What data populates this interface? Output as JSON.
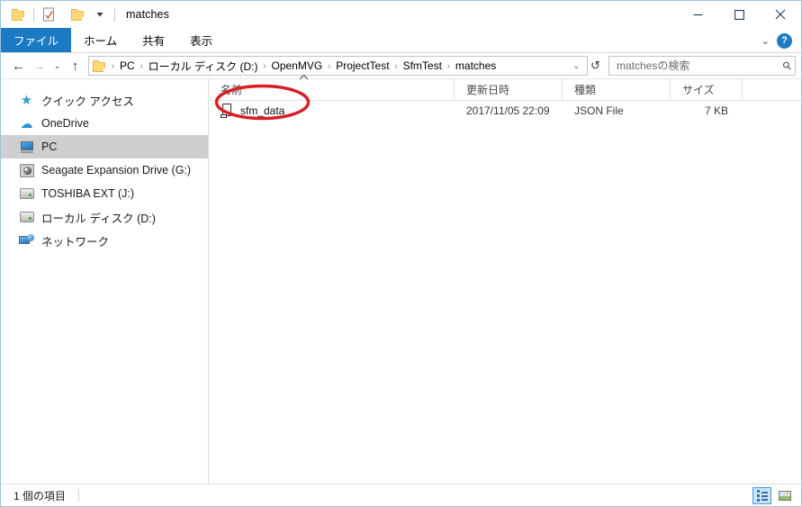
{
  "window": {
    "title": "matches",
    "quick_access": [
      {
        "name": "folder-icon",
        "label": "folder"
      },
      {
        "name": "properties-icon",
        "label": "properties"
      },
      {
        "name": "new-folder-icon",
        "label": "new folder"
      }
    ],
    "controls": {
      "minimize": "—",
      "maximize": "☐",
      "close": "✕"
    }
  },
  "ribbon": {
    "tabs": [
      {
        "label": "ファイル",
        "active": true
      },
      {
        "label": "ホーム",
        "active": false
      },
      {
        "label": "共有",
        "active": false
      },
      {
        "label": "表示",
        "active": false
      }
    ],
    "expand_icon": "⌄",
    "help_icon": "?"
  },
  "address": {
    "back_icon": "←",
    "forward_icon": "→",
    "recent_icon": "⌄",
    "up_icon": "↑",
    "breadcrumbs": [
      "PC",
      "ローカル ディスク (D:)",
      "OpenMVG",
      "ProjectTest",
      "SfmTest",
      "matches"
    ],
    "separator": "›",
    "dropdown_icon": "⌄",
    "refresh_icon": "↻"
  },
  "search": {
    "placeholder": "matchesの検索",
    "value": "",
    "icon": "search-icon"
  },
  "sidebar": {
    "items": [
      {
        "label": "クイック アクセス",
        "icon": "star-icon",
        "selected": false
      },
      {
        "label": "OneDrive",
        "icon": "cloud-icon",
        "selected": false
      },
      {
        "label": "PC",
        "icon": "computer-icon",
        "selected": true
      },
      {
        "label": "Seagate Expansion Drive (G:)",
        "icon": "external-drive-icon",
        "selected": false
      },
      {
        "label": "TOSHIBA EXT (J:)",
        "icon": "disk-drive-icon",
        "selected": false
      },
      {
        "label": "ローカル ディスク (D:)",
        "icon": "disk-drive-icon",
        "selected": false
      },
      {
        "label": "ネットワーク",
        "icon": "network-icon",
        "selected": false
      }
    ]
  },
  "filelist": {
    "columns": [
      {
        "label": "名前",
        "key": "name"
      },
      {
        "label": "更新日時",
        "key": "date"
      },
      {
        "label": "種類",
        "key": "type"
      },
      {
        "label": "サイズ",
        "key": "size"
      }
    ],
    "sort_caret": "▲",
    "rows": [
      {
        "name": "sfm_data",
        "date": "2017/11/05 22:09",
        "type": "JSON File",
        "size": "7 KB",
        "icon": "json-file-icon",
        "annotated": true
      }
    ]
  },
  "annotation": {
    "shape": "ellipse",
    "color": "#d81f26",
    "target": "sfm_data"
  },
  "status": {
    "item_count_text": "1 個の項目",
    "views": [
      {
        "name": "details-view",
        "active": true
      },
      {
        "name": "large-icons-view",
        "active": false
      }
    ]
  },
  "colors": {
    "accent": "#1a7bc4",
    "selection": "#cfcfcf",
    "annotation": "#d81f26",
    "folder": "#fcd975"
  }
}
